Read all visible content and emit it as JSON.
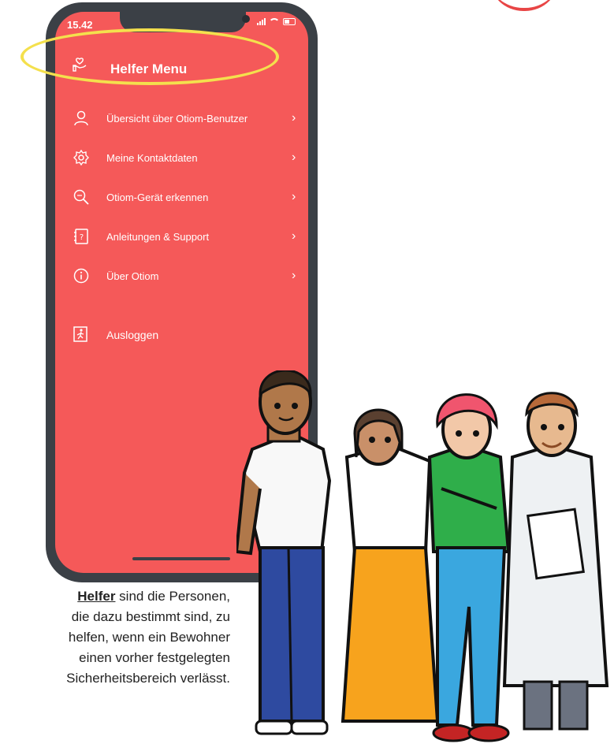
{
  "status_bar": {
    "time": "15.42"
  },
  "menu": {
    "title": "Helfer Menu",
    "items": [
      {
        "label": "Übersicht über Otiom-Benutzer",
        "icon": "user-icon",
        "chevron": true
      },
      {
        "label": "Meine Kontaktdaten",
        "icon": "gear-icon",
        "chevron": true
      },
      {
        "label": "Otiom-Gerät erkennen",
        "icon": "search-icon",
        "chevron": true
      },
      {
        "label": "Anleitungen & Support",
        "icon": "help-book-icon",
        "chevron": true
      },
      {
        "label": "Über Otiom",
        "icon": "info-icon",
        "chevron": true
      },
      {
        "label": "Ausloggen",
        "icon": "logout-icon",
        "chevron": false
      }
    ]
  },
  "caption": {
    "term": "Helfer",
    "line1": " sind die Personen,",
    "line2": "die dazu bestimmt sind, zu",
    "line3": "helfen, wenn ein Bewohner",
    "line4": "einen vorher festgelegten",
    "line5": "Sicherheitsbereich verlässt."
  },
  "colors": {
    "menu_bg": "#f55959",
    "phone_frame": "#3b4046",
    "highlight": "#f4e04d"
  }
}
